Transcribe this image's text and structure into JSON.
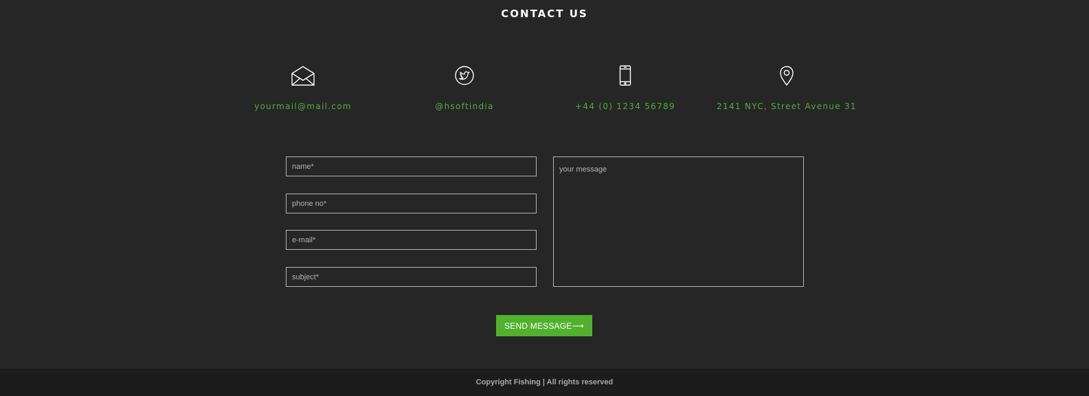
{
  "section": {
    "title": "CONTACT US"
  },
  "contacts": [
    {
      "icon": "envelope-icon",
      "text": "yourmail@mail.com"
    },
    {
      "icon": "twitter-icon",
      "text": "@hsoftindia"
    },
    {
      "icon": "smartphone-icon",
      "text": "+44 (0) 1234 56789"
    },
    {
      "icon": "map-pin-icon",
      "text": "2141 NYC, Street Avenue 31"
    }
  ],
  "form": {
    "name_placeholder": "name*",
    "phone_placeholder": "phone no*",
    "email_placeholder": "e-mail*",
    "subject_placeholder": "subject*",
    "message_placeholder": "your message",
    "send_label": "SEND MESSAGE⟶"
  },
  "footer": {
    "copyright": "Copyright Fishing | All rights reserved"
  },
  "colors": {
    "background": "#262626",
    "accent": "#51b12e",
    "contact_text": "#4caf35",
    "footer_bg": "#1c1c1c"
  }
}
